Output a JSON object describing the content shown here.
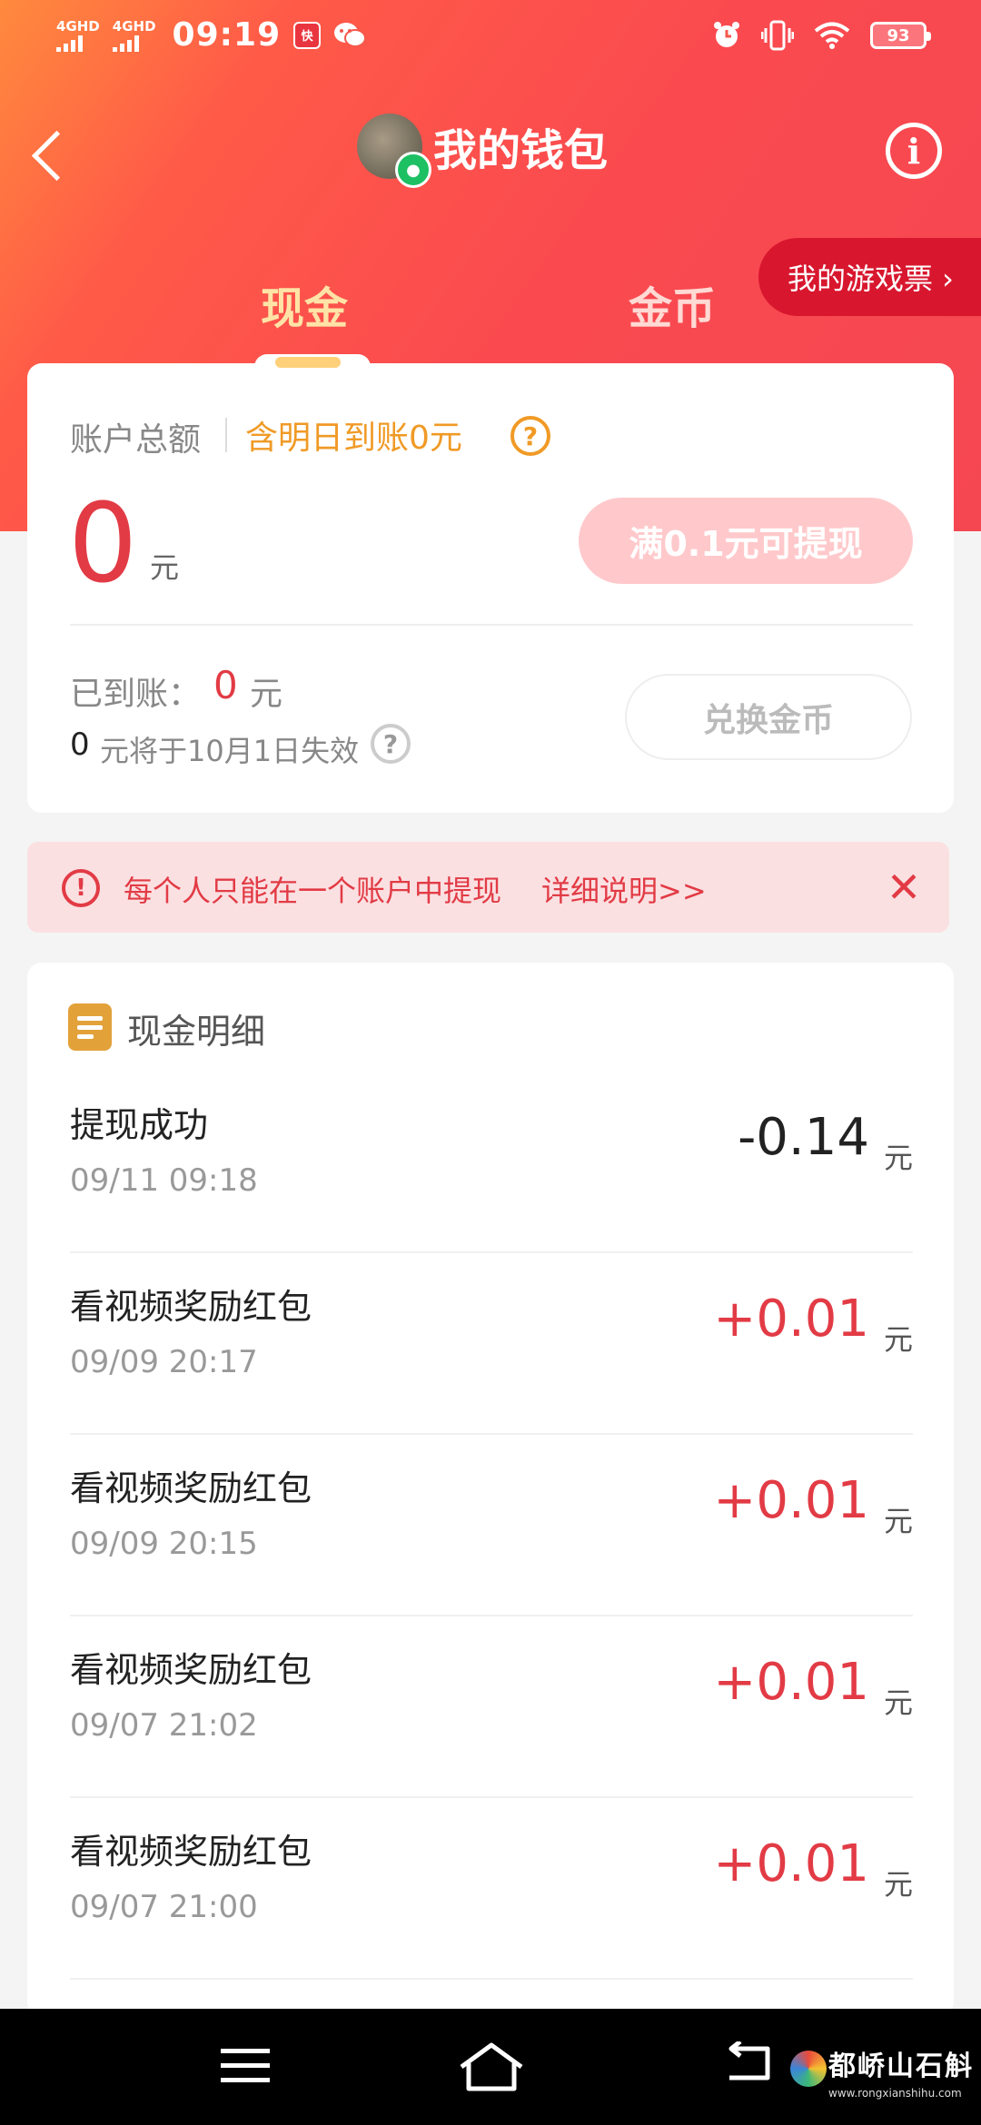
{
  "status_bar": {
    "sim1": "4GHD",
    "sim2": "4GHD",
    "time": "09:19",
    "app_badge": "快",
    "battery": "93"
  },
  "header": {
    "title": "我的钱包",
    "tabs": [
      "现金",
      "金币"
    ],
    "active_tab": "现金",
    "game_ticket": "我的游戏票 ›"
  },
  "account": {
    "total_label": "账户总额",
    "tomorrow_text": "含明日到账0元",
    "balance": "0",
    "balance_unit": "元",
    "withdraw_button": "满0.1元可提现",
    "arrived_label": "已到账：",
    "arrived_value": "0",
    "arrived_unit": "元",
    "expire_value": "0",
    "expire_text": "元将于10月1日失效",
    "exchange_button": "兑换金币"
  },
  "notice": {
    "text": "每个人只能在一个账户中提现",
    "link": "详细说明>>",
    "close": "✕"
  },
  "details": {
    "title": "现金明细",
    "unit": "元",
    "items": [
      {
        "title": "提现成功",
        "time": "09/11 09:18",
        "amount": "-0.14"
      },
      {
        "title": "看视频奖励红包",
        "time": "09/09 20:17",
        "amount": "+0.01"
      },
      {
        "title": "看视频奖励红包",
        "time": "09/09 20:15",
        "amount": "+0.01"
      },
      {
        "title": "看视频奖励红包",
        "time": "09/07 21:02",
        "amount": "+0.01"
      },
      {
        "title": "看视频奖励红包",
        "time": "09/07 21:00",
        "amount": "+0.01"
      }
    ]
  },
  "watermark": {
    "name": "都峤山石斛",
    "url": "www.rongxianshihu.com"
  },
  "colors": {
    "header_red": "#f54752",
    "accent_red": "#e23b45",
    "accent_orange": "#f09a26"
  }
}
